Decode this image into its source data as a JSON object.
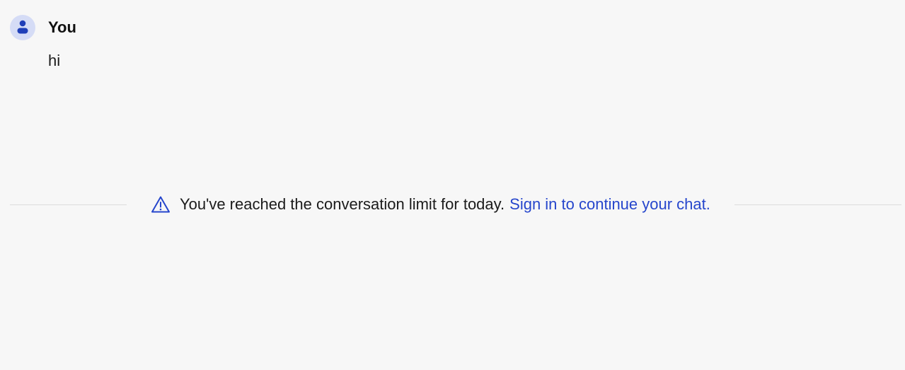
{
  "message": {
    "author": "You",
    "text": "hi",
    "avatar_icon": "person-icon",
    "avatar_bg": "#d5dcf6",
    "avatar_fg": "#1f3fb8"
  },
  "notice": {
    "icon": "warning-icon",
    "text": "You've reached the conversation limit for today.",
    "link_text": "Sign in to continue your chat.",
    "link_color": "#2646cc"
  }
}
